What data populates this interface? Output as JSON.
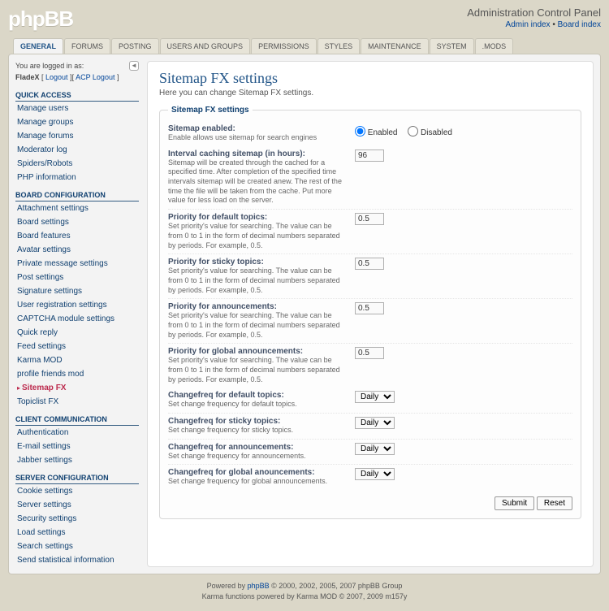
{
  "hdr": {
    "logo": "phpBB",
    "title": "Administration Control Panel",
    "link1": "Admin index",
    "link2": "Board index",
    "sep": " • "
  },
  "tabs": [
    "GENERAL",
    "FORUMS",
    "POSTING",
    "USERS AND GROUPS",
    "PERMISSIONS",
    "STYLES",
    "MAINTENANCE",
    "SYSTEM",
    ".MODS"
  ],
  "login": {
    "line1": "You are logged in as:",
    "user": "FladeX",
    "logout": "Logout",
    "acp": "ACP Logout"
  },
  "sections": [
    {
      "head": "QUICK ACCESS",
      "items": [
        "Manage users",
        "Manage groups",
        "Manage forums",
        "Moderator log",
        "Spiders/Robots",
        "PHP information"
      ]
    },
    {
      "head": "BOARD CONFIGURATION",
      "items": [
        "Attachment settings",
        "Board settings",
        "Board features",
        "Avatar settings",
        "Private message settings",
        "Post settings",
        "Signature settings",
        "User registration settings",
        "CAPTCHA module settings",
        "Quick reply",
        "Feed settings",
        "Karma MOD",
        "profile friends mod",
        "Sitemap FX",
        "Topiclist FX"
      ],
      "active": 13
    },
    {
      "head": "CLIENT COMMUNICATION",
      "items": [
        "Authentication",
        "E-mail settings",
        "Jabber settings"
      ]
    },
    {
      "head": "SERVER CONFIGURATION",
      "items": [
        "Cookie settings",
        "Server settings",
        "Security settings",
        "Load settings",
        "Search settings",
        "Send statistical information"
      ]
    }
  ],
  "page": {
    "h1": "Sitemap FX settings",
    "sub": "Here you can change Sitemap FX settings.",
    "legend": "Sitemap FX settings",
    "enabled_lbl": "Sitemap enabled:",
    "enabled_desc": "Enable allows use sitemap for search engines",
    "opt_en": "Enabled",
    "opt_dis": "Disabled",
    "fields": [
      {
        "lbl": "Interval caching sitemap (in hours):",
        "desc": "Sitemap will be created through the cached for a specified time. After completion of the specified time intervals sitemap will be created anew. The rest of the time the file will be taken from the cache. Put more value for less load on the server.",
        "val": "96"
      },
      {
        "lbl": "Priority for default topics:",
        "desc": "Set priority's value for searching. The value can be from 0 to 1 in the form of decimal numbers separated by periods. For example, 0.5.",
        "val": "0.5"
      },
      {
        "lbl": "Priority for sticky topics:",
        "desc": "Set priority's value for searching. The value can be from 0 to 1 in the form of decimal numbers separated by periods. For example, 0.5.",
        "val": "0.5"
      },
      {
        "lbl": "Priority for announcements:",
        "desc": "Set priority's value for searching. The value can be from 0 to 1 in the form of decimal numbers separated by periods. For example, 0.5.",
        "val": "0.5"
      },
      {
        "lbl": "Priority for global announcements:",
        "desc": "Set priority's value for searching. The value can be from 0 to 1 in the form of decimal numbers separated by periods. For example, 0.5.",
        "val": "0.5"
      }
    ],
    "selects": [
      {
        "lbl": "Changefreq for default topics:",
        "desc": "Set change frequency for default topics.",
        "val": "Daily"
      },
      {
        "lbl": "Changefreq for sticky topics:",
        "desc": "Set change frequency for sticky topics.",
        "val": "Daily"
      },
      {
        "lbl": "Changefreq for announcements:",
        "desc": "Set change frequency for announcements.",
        "val": "Daily"
      },
      {
        "lbl": "Changefreq for global anouncements:",
        "desc": "Set change frequency for global announcements.",
        "val": "Daily"
      }
    ],
    "submit": "Submit",
    "reset": "Reset"
  },
  "footer": {
    "l1a": "Powered by ",
    "l1b": "phpBB",
    "l1c": " © 2000, 2002, 2005, 2007 phpBB Group",
    "l2": "Karma functions powered by Karma MOD © 2007, 2009 m157y"
  }
}
